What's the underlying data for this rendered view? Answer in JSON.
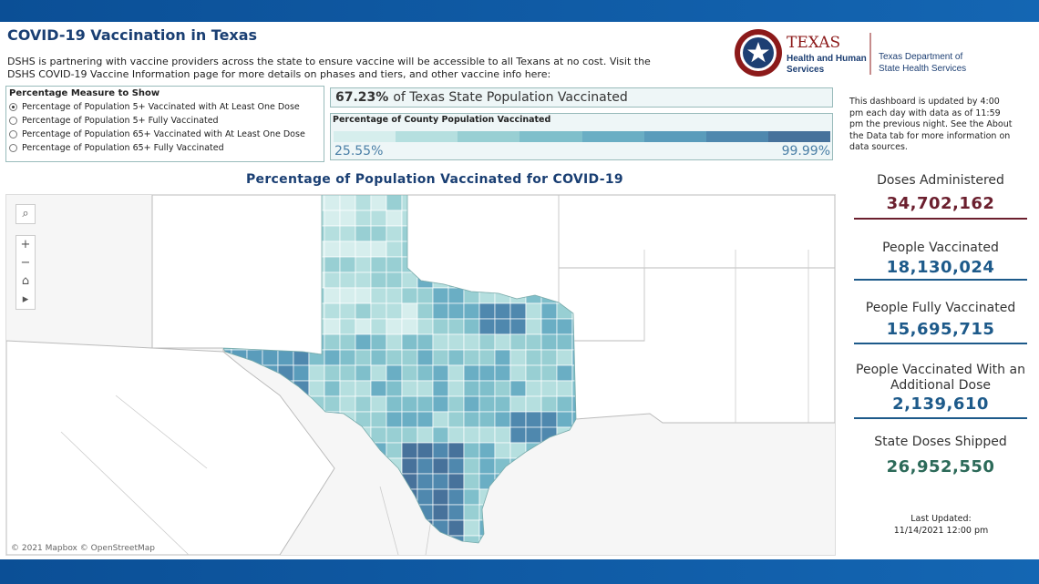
{
  "header": {
    "title": "COVID-19 Vaccination in Texas",
    "intro": "DSHS is partnering with vaccine providers across the state to ensure vaccine will be accessible to all Texans at no cost. Visit the DSHS COVID-19 Vaccine Information page for more details on phases and tiers, and other vaccine info here:"
  },
  "logo": {
    "texas": "TEXAS",
    "hhs_line1": "Health and Human",
    "hhs_line2": "Services",
    "dshs_line1": "Texas Department of",
    "dshs_line2": "State Health Services",
    "seal_color": "#8c1a1a"
  },
  "measure": {
    "heading": "Percentage Measure to Show",
    "options": [
      {
        "label": "Percentage of Population 5+ Vaccinated with At Least One Dose",
        "selected": true
      },
      {
        "label": "Percentage of Population 5+ Fully Vaccinated",
        "selected": false
      },
      {
        "label": "Percentage of Population 65+ Vaccinated with At Least One Dose",
        "selected": false
      },
      {
        "label": "Percentage of Population 65+ Fully Vaccinated",
        "selected": false
      }
    ]
  },
  "state_pct": {
    "value": "67.23%",
    "text": "of Texas State Population Vaccinated"
  },
  "legend": {
    "heading": "Percentage of County Population Vaccinated",
    "min": "25.55%",
    "max": "99.99%",
    "colors": [
      "#d6eeed",
      "#b5dfdf",
      "#98cfd3",
      "#7fbfcb",
      "#6aaec4",
      "#5a9cbb",
      "#4f88ae",
      "#47729b"
    ]
  },
  "update_note": "This dashboard is updated by 4:00 pm each day with data as of 11:59 pm the previous night. See the About the Data tab for more information on data sources.",
  "map": {
    "title": "Percentage of Population Vaccinated for COVID-19",
    "attribution": "© 2021 Mapbox  © OpenStreetMap",
    "controls": {
      "search": "⌕",
      "zoom_in": "+",
      "zoom_out": "−",
      "home": "⌂",
      "play": "▸"
    }
  },
  "stats": [
    {
      "label": "Doses Administered",
      "value": "34,702,162",
      "color": "#6b1f2e"
    },
    {
      "label": "People Vaccinated",
      "value": "18,130,024",
      "color": "#1d5a8a"
    },
    {
      "label": "People Fully Vaccinated",
      "value": "15,695,715",
      "color": "#1d5a8a"
    },
    {
      "label": "People Vaccinated With an Additional Dose",
      "value": "2,139,610",
      "color": "#1d5a8a"
    },
    {
      "label": "State Doses Shipped",
      "value": "26,952,550",
      "color": "#2c6a59"
    }
  ],
  "last_updated": {
    "label": "Last Updated:",
    "value": "11/14/2021 12:00 pm"
  }
}
